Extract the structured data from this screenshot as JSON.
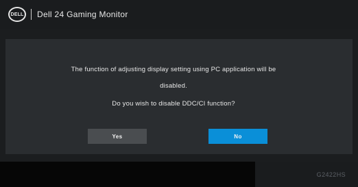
{
  "header": {
    "logo_text": "DELL",
    "title": "Dell 24 Gaming Monitor"
  },
  "dialog": {
    "message_line1": "The function of adjusting display setting using PC application will be",
    "message_line2": "disabled.",
    "message_line3": "Do you wish to disable DDC/CI function?",
    "yes_label": "Yes",
    "no_label": "No"
  },
  "footer": {
    "code": "G2422HS"
  },
  "colors": {
    "selected_button": "#0a8fd8",
    "unselected_button": "#4a4d50"
  }
}
